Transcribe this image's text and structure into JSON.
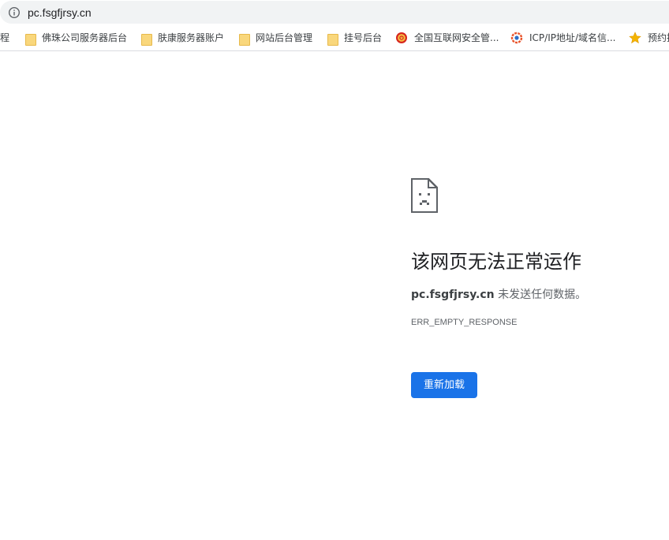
{
  "address_bar": {
    "url": "pc.fsgfjrsy.cn",
    "icon": "info-icon"
  },
  "bookmarks": [
    {
      "label": "程",
      "icon": "none"
    },
    {
      "label": "佛珠公司服务器后台",
      "icon": "folder-icon"
    },
    {
      "label": "肤康服务器账户",
      "icon": "folder-icon"
    },
    {
      "label": "网站后台管理",
      "icon": "folder-icon"
    },
    {
      "label": "挂号后台",
      "icon": "folder-icon"
    },
    {
      "label": "全国互联网安全管...",
      "icon": "emblem-icon"
    },
    {
      "label": "ICP/IP地址/域名信...",
      "icon": "icp-icon"
    },
    {
      "label": "预约挂",
      "icon": "star-icon"
    }
  ],
  "error_page": {
    "icon": "sad-page-icon",
    "title": "该网页无法正常运作",
    "host": "pc.fsgfjrsy.cn",
    "message": " 未发送任何数据。",
    "code": "ERR_EMPTY_RESPONSE",
    "reload_label": "重新加载"
  },
  "colors": {
    "accent": "#1a73e8",
    "omnibox_bg": "#f1f3f4",
    "text": "#202124",
    "secondary_text": "#5f6368"
  }
}
